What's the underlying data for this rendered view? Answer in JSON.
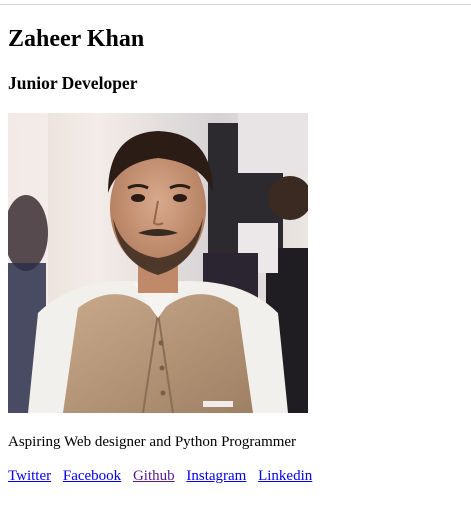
{
  "profile": {
    "name": "Zaheer Khan",
    "role": "Junior Developer",
    "bio": "Aspiring Web designer and Python Programmer"
  },
  "photo": {
    "subject": "portrait photo of a young man in a beige waistcoat over white shirt"
  },
  "links": [
    {
      "label": "Twitter",
      "visited": false
    },
    {
      "label": "Facebook",
      "visited": false
    },
    {
      "label": "Github",
      "visited": true
    },
    {
      "label": "Instagram",
      "visited": false
    },
    {
      "label": "Linkedin",
      "visited": false
    }
  ],
  "colors": {
    "link": "#0000ee",
    "visited_link": "#551a8b",
    "text": "#000000",
    "background": "#ffffff"
  }
}
